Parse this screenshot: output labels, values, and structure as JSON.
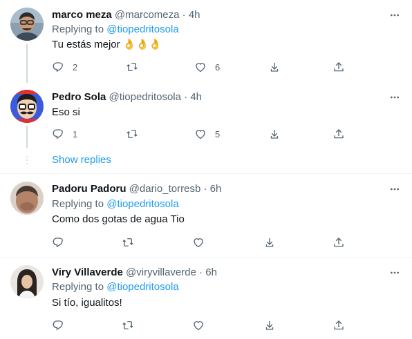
{
  "colors": {
    "accent": "#1d9bf0",
    "secondary": "#536471",
    "text": "#0f1419"
  },
  "icons": {
    "more": "more-horizontal-icon",
    "reply": "reply-icon",
    "retweet": "retweet-icon",
    "like": "heart-icon",
    "share": "share-icon",
    "upload": "upload-icon"
  },
  "tweets": [
    {
      "name": "marco meza",
      "handle": "@marcomeza",
      "dot": "·",
      "time": "4h",
      "replying_prefix": "Replying to",
      "replying_to": "@tiopedritosola",
      "text": "Tu estás mejor 👌👌👌",
      "counts": {
        "reply": "2",
        "retweet": "",
        "like": "6"
      }
    },
    {
      "name": "Pedro Sola",
      "handle": "@tiopedritosola",
      "dot": "·",
      "time": "4h",
      "text": "Eso si",
      "counts": {
        "reply": "1",
        "retweet": "",
        "like": "5"
      }
    },
    {
      "name": "Padoru Padoru",
      "handle": "@dario_torresb",
      "dot": "·",
      "time": "6h",
      "replying_prefix": "Replying to",
      "replying_to": "@tiopedritosola",
      "text": "Como dos gotas de agua Tio",
      "counts": {
        "reply": "",
        "retweet": "",
        "like": ""
      }
    },
    {
      "name": "Viry Villaverde",
      "handle": "@viryvillaverde",
      "dot": "·",
      "time": "6h",
      "replying_prefix": "Replying to",
      "replying_to": "@tiopedritosola",
      "text": "Si tío, igualitos!",
      "counts": {
        "reply": "",
        "retweet": "",
        "like": ""
      }
    }
  ],
  "show_replies": "Show replies"
}
